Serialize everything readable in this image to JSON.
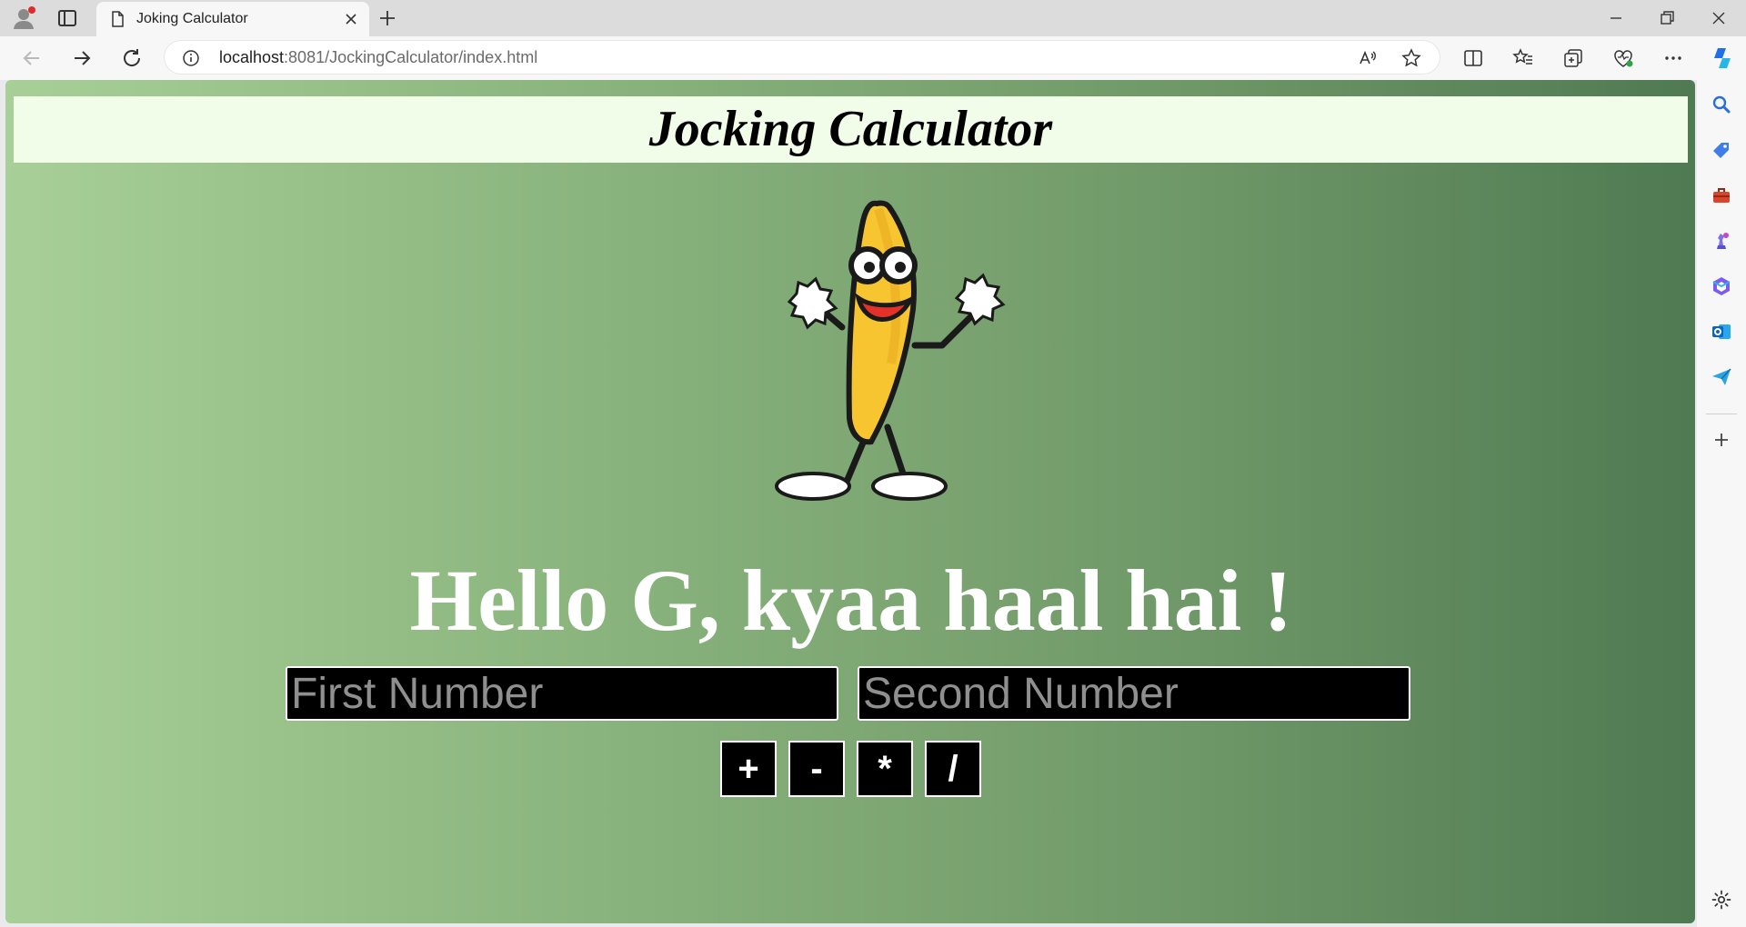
{
  "browser": {
    "tab_title": "Joking Calculator",
    "url_host": "localhost",
    "url_rest": ":8081/JockingCalculator/index.html"
  },
  "page": {
    "header_title": "Jocking Calculator",
    "greeting": "Hello G, kyaa haal hai !",
    "first_placeholder": "First Number",
    "second_placeholder": "Second Number",
    "first_value": "",
    "second_value": "",
    "operators": {
      "add": "+",
      "subtract": "-",
      "multiply": "*",
      "divide": "/"
    }
  },
  "colors": {
    "gradient_left": "#a7cf97",
    "gradient_right": "#4f7a52",
    "header_bg": "#f1fde9",
    "input_bg": "#000000",
    "text_light": "#ffffff"
  }
}
